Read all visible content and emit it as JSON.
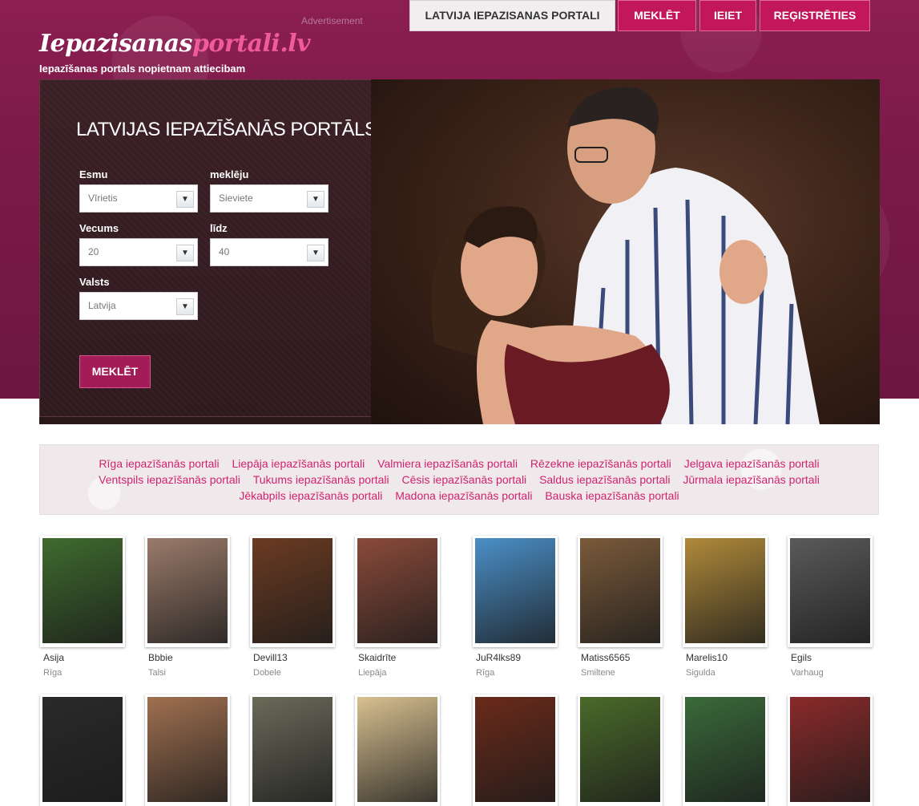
{
  "advertisement": "Advertisement",
  "logo": {
    "part1": "Iepazisanas",
    "part2": "portali.lv"
  },
  "tagline": "Iepazīšanas portals nopietnam attiecibam",
  "nav": [
    {
      "label": "LATVIJA IEPAZISANAS PORTALI",
      "active": true
    },
    {
      "label": "MEKLĒT",
      "active": false
    },
    {
      "label": "IEIET",
      "active": false
    },
    {
      "label": "REĢISTRĒTIES",
      "active": false
    }
  ],
  "search": {
    "title": "LATVIJAS IEPAZĪŠANĀS PORTĀLS",
    "esmu_label": "Esmu",
    "esmu_value": "Vīrietis",
    "mekleju_label": "meklēju",
    "mekleju_value": "Sieviete",
    "vecums_label": "Vecums",
    "vecums_value": "20",
    "lidz_label": "līdz",
    "lidz_value": "40",
    "valsts_label": "Valsts",
    "valsts_value": "Latvija",
    "button": "MEKLĒT"
  },
  "cities": {
    "line1": [
      "Rīga iepazīšanās portali",
      "Liepāja iepazīšanās portali",
      "Valmiera iepazīšanās portali",
      "Rēzekne iepazīšanās portali",
      "Jelgava iepazīšanās portali"
    ],
    "line2": [
      "Ventspils iepazīšanās portali",
      "Tukums iepazīšanās portali",
      "Cēsis iepazīšanās portali",
      "Saldus iepazīšanās portali",
      "Jūrmala iepazīšanās portali"
    ],
    "line3": [
      "Jēkabpils iepazīšanās portali",
      "Madona iepazīšanās portali",
      "Bauska iepazīšanās portali"
    ]
  },
  "profiles": [
    {
      "name": "Asija",
      "city": "Rīga",
      "color": "#3f6b2e"
    },
    {
      "name": "Bbbie",
      "city": "Talsi",
      "color": "#9a7b6a"
    },
    {
      "name": "Devill13",
      "city": "Dobele",
      "color": "#6b3b22"
    },
    {
      "name": "Skaidrīte",
      "city": "Liepāja",
      "color": "#8a4a3a"
    },
    {
      "name": "JuR4lks89",
      "city": "Rīga",
      "color": "#4a8fc7"
    },
    {
      "name": "Matiss6565",
      "city": "Smiltene",
      "color": "#7a5a3a"
    },
    {
      "name": "Marelis10",
      "city": "Sigulda",
      "color": "#b08a3a"
    },
    {
      "name": "Egils",
      "city": "Varhaug",
      "color": "#5a5a5a"
    }
  ],
  "profiles_row2": [
    {
      "color": "#2a2a2a"
    },
    {
      "color": "#a07050"
    },
    {
      "color": "#6a6a5a"
    },
    {
      "color": "#d8c090"
    },
    {
      "color": "#6a2a1a"
    },
    {
      "color": "#4a6a2a"
    },
    {
      "color": "#3a6a3a"
    },
    {
      "color": "#8a2a2a"
    }
  ]
}
